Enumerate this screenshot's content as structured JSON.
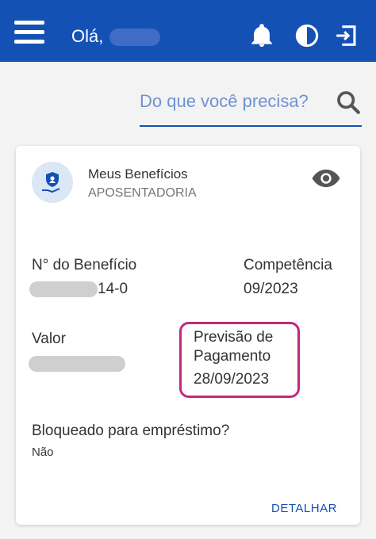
{
  "header": {
    "greeting": "Olá,",
    "background": "#1451b4"
  },
  "search": {
    "placeholder": "Do que você precisa?"
  },
  "card": {
    "title": "Meus Benefícios",
    "subtitle": "APOSENTADORIA",
    "benefit_number_label": "N° do Benefício",
    "benefit_number_visible": "14-0",
    "competence_label": "Competência",
    "competence_value": "09/2023",
    "amount_label": "Valor",
    "payment_forecast_label_line1": "Previsão de",
    "payment_forecast_label_line2": "Pagamento",
    "payment_forecast_value": "28/09/2023",
    "blocked_label": "Bloqueado para empréstimo?",
    "blocked_value": "Não",
    "detail_link": "DETALHAR"
  },
  "colors": {
    "accent": "#1451b4",
    "highlight": "#c2287c"
  },
  "icons": [
    "menu-icon",
    "bell-icon",
    "contrast-icon",
    "logout-icon",
    "search-icon",
    "shield-hand-icon",
    "eye-icon"
  ]
}
